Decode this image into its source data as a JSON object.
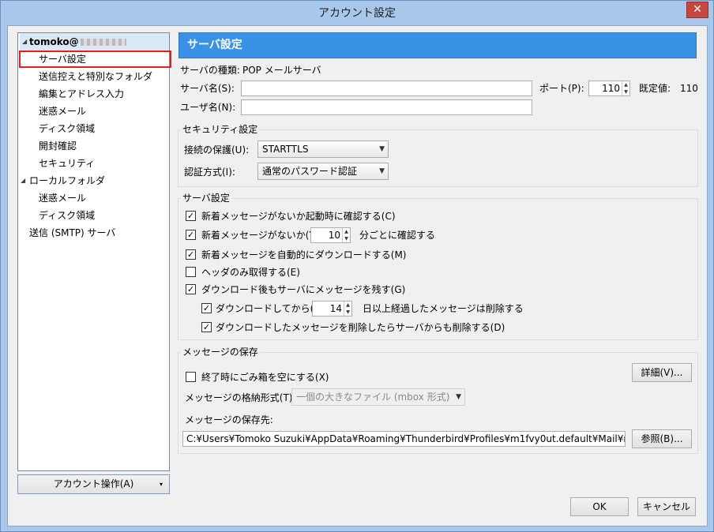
{
  "window": {
    "title": "アカウント設定",
    "close_glyph": "✕"
  },
  "tree": {
    "account_name": "tomoko@",
    "items": [
      {
        "label": "サーバ設定"
      },
      {
        "label": "送信控えと特別なフォルダ"
      },
      {
        "label": "編集とアドレス入力"
      },
      {
        "label": "迷惑メール"
      },
      {
        "label": "ディスク領域"
      },
      {
        "label": "開封確認"
      },
      {
        "label": "セキュリティ"
      }
    ],
    "local_folder": "ローカルフォルダ",
    "local_items": [
      {
        "label": "迷惑メール"
      },
      {
        "label": "ディスク領域"
      }
    ],
    "smtp": "送信 (SMTP) サーバ",
    "account_actions": "アカウント操作(A)",
    "account_actions_arrow": "▾"
  },
  "panel": {
    "title": "サーバ設定",
    "server_type_label": "サーバの種類:",
    "server_type_value": "POP メールサーバ",
    "server_name_label": "サーバ名(S):",
    "server_name_value": "",
    "port_label": "ポート(P):",
    "port_value": "110",
    "default_label": "既定値:",
    "default_value": "110",
    "user_name_label": "ユーザ名(N):",
    "user_name_value": ""
  },
  "security": {
    "title": "セキュリティ設定",
    "connection_label": "接続の保護(U):",
    "connection_value": "STARTTLS",
    "auth_label": "認証方式(I):",
    "auth_value": "通常のパスワード認証"
  },
  "server_settings": {
    "title": "サーバ設定",
    "check_on_startup": {
      "label": "新着メッセージがないか起動時に確認する(C)",
      "checked": true
    },
    "check_every": {
      "label": "新着メッセージがないか(Y)",
      "checked": true,
      "minutes": "10",
      "suffix": "分ごとに確認する"
    },
    "auto_download": {
      "label": "新着メッセージを自動的にダウンロードする(M)",
      "checked": true
    },
    "headers_only": {
      "label": "ヘッダのみ取得する(E)",
      "checked": false
    },
    "leave_on_server": {
      "label": "ダウンロード後もサーバにメッセージを残す(G)",
      "checked": true
    },
    "delete_after": {
      "label": "ダウンロードしてから(O)",
      "checked": true,
      "days": "14",
      "suffix": "日以上経過したメッセージは削除する"
    },
    "delete_from_server": {
      "label": "ダウンロードしたメッセージを削除したらサーバからも削除する(D)",
      "checked": true
    }
  },
  "storage": {
    "title": "メッセージの保存",
    "empty_trash": {
      "label": "終了時にごみ箱を空にする(X)",
      "checked": false
    },
    "advanced_button": "詳細(V)...",
    "format_label": "メッセージの格納形式(T):",
    "format_value": "一個の大きなファイル (mbox 形式)",
    "location_label": "メッセージの保存先:",
    "location_value": "C:¥Users¥Tomoko Suzuki¥AppData¥Roaming¥Thunderbird¥Profiles¥m1fvy0ut.default¥Mail¥m",
    "browse_button": "参照(B)..."
  },
  "footer": {
    "ok": "OK",
    "cancel": "キャンセル"
  },
  "checkmark": "✓",
  "icons": {
    "spin_up": "▲",
    "spin_down": "▼",
    "dropdown": "▼",
    "expand": "◢"
  }
}
